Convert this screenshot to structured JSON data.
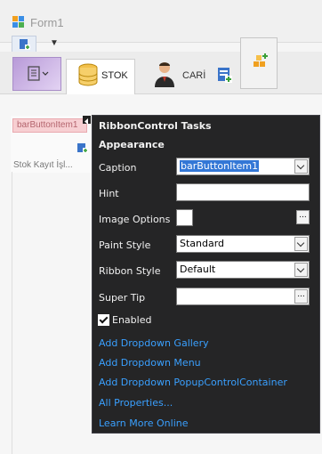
{
  "window": {
    "title": "Form1"
  },
  "ribbon": {
    "tabs": [
      {
        "label": "STOK"
      },
      {
        "label": "CARİ"
      }
    ],
    "bar_item_label": "barButtonItem1",
    "group_caption": "Stok Kayıt İşl..."
  },
  "panel": {
    "title": "RibbonControl Tasks",
    "section": "Appearance",
    "caption_label": "Caption",
    "caption_value": "barButtonItem1",
    "hint_label": "Hint",
    "hint_value": "",
    "image_options_label": "Image Options",
    "paint_style_label": "Paint Style",
    "paint_style_value": "Standard",
    "ribbon_style_label": "Ribbon Style",
    "ribbon_style_value": "Default",
    "super_tip_label": "Super Tip",
    "enabled_label": "Enabled",
    "enabled": true,
    "ellipsis": "...",
    "links": [
      "Add Dropdown Gallery",
      "Add Dropdown Menu",
      "Add Dropdown PopupControlContainer",
      "All Properties...",
      "Learn More Online"
    ]
  },
  "colors": {
    "link": "#3aa0ff",
    "panel_bg": "#252526",
    "selection": "#3377d6",
    "bar_item_bg": "#f7cfd2"
  }
}
